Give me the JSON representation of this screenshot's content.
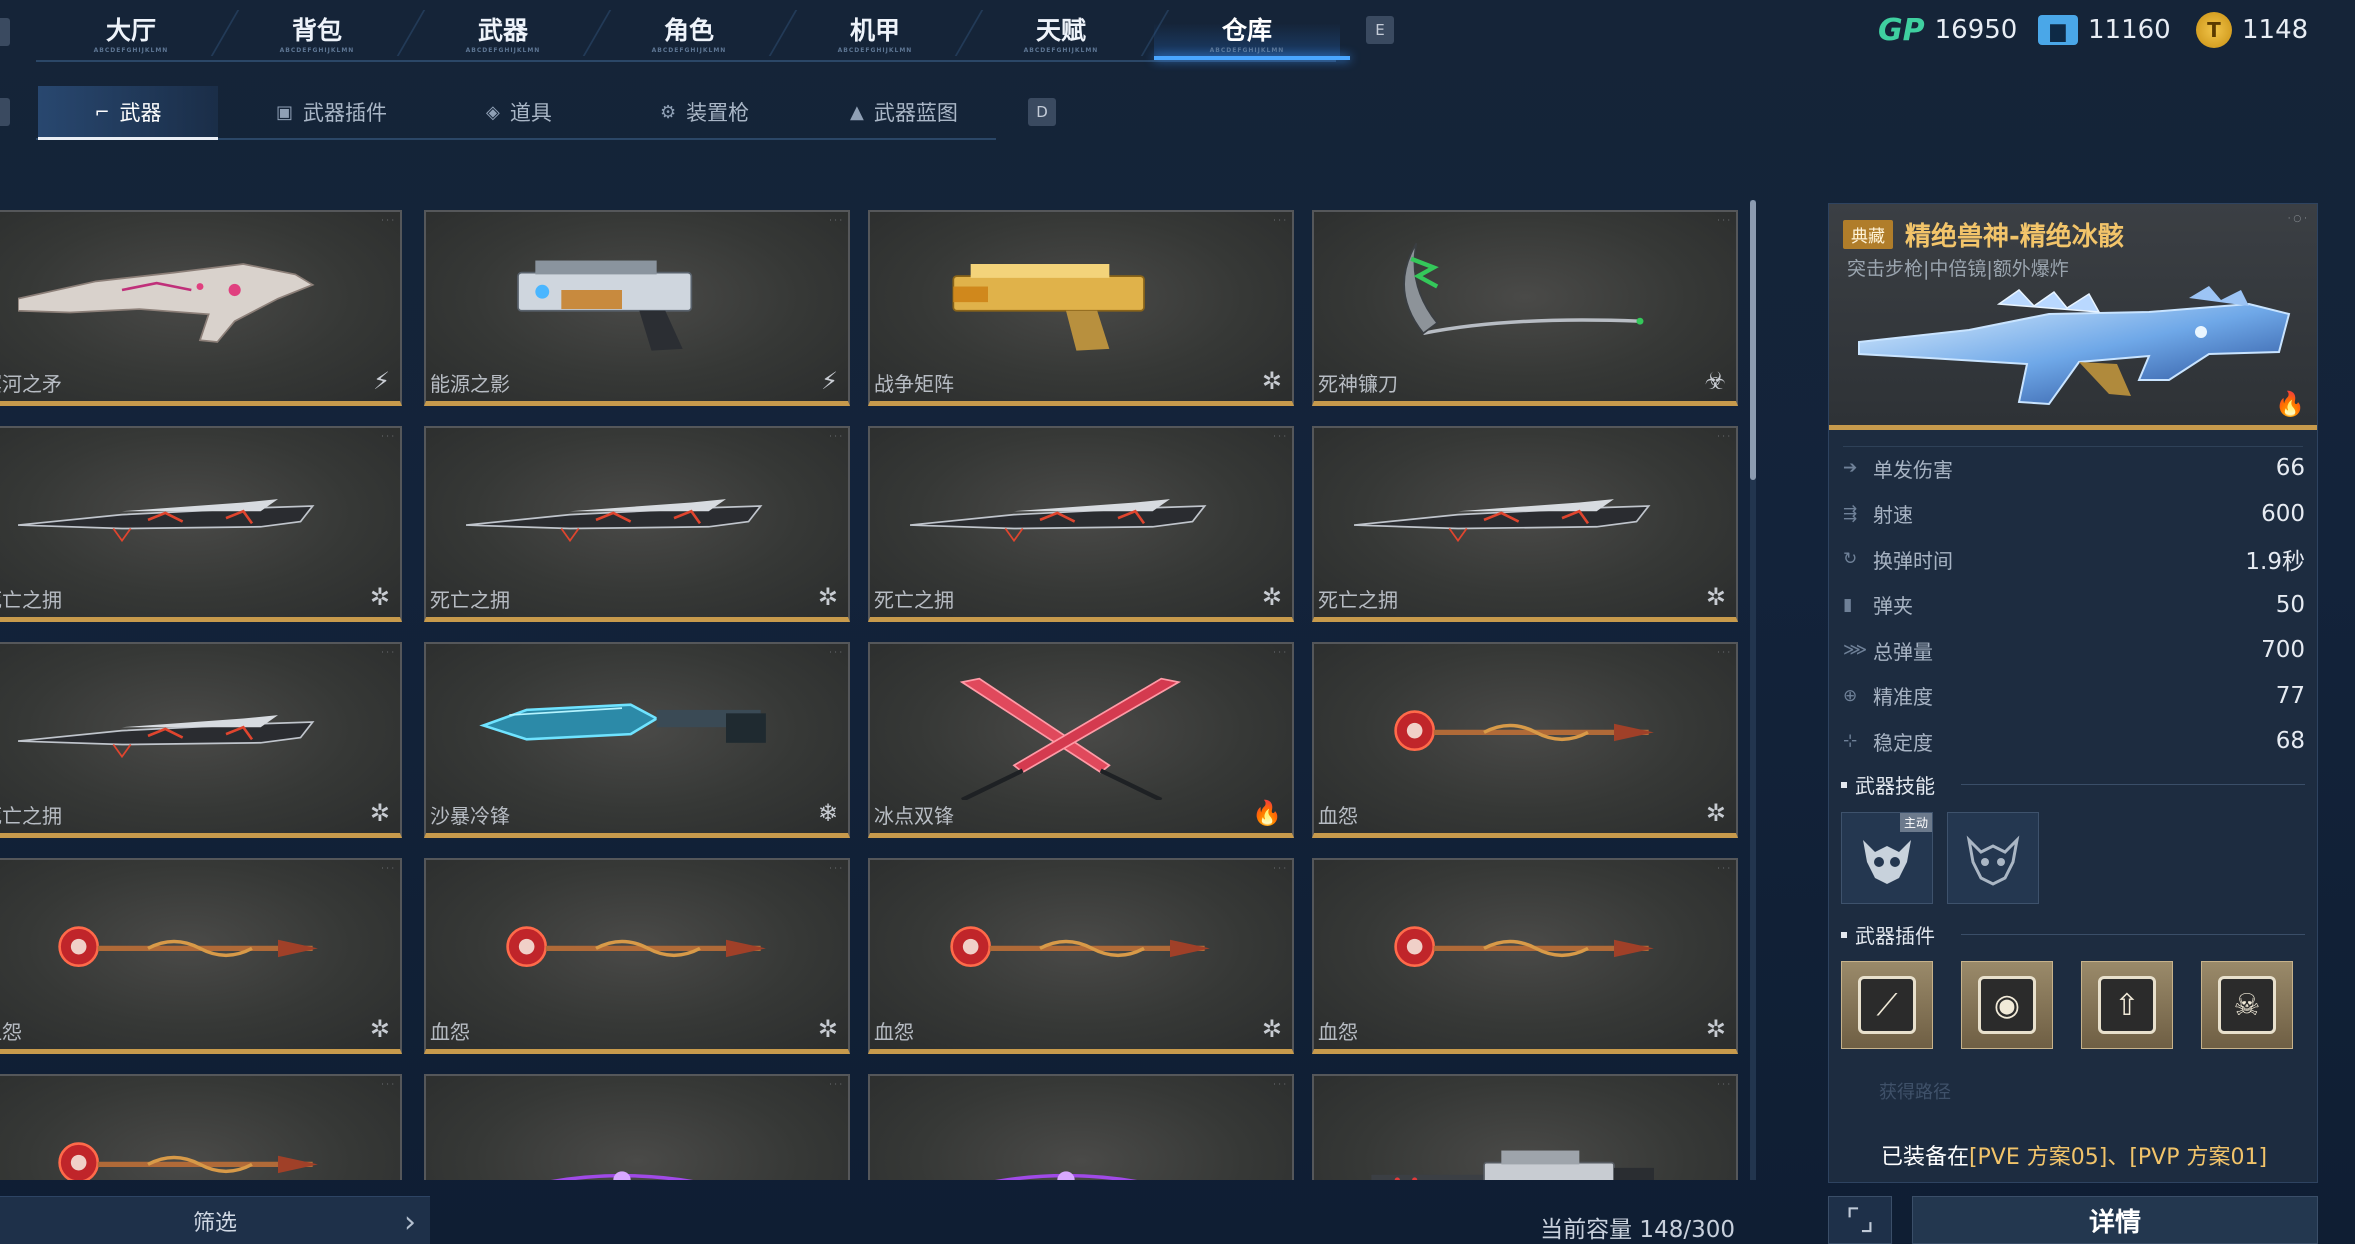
{
  "top_nav": {
    "tabs": [
      {
        "label": "大厅",
        "sub": "ABCDEFGHIJKLMN"
      },
      {
        "label": "背包",
        "sub": "ABCDEFGHIJKLMN"
      },
      {
        "label": "武器",
        "sub": "ABCDEFGHIJKLMN"
      },
      {
        "label": "角色",
        "sub": "ABCDEFGHIJKLMN"
      },
      {
        "label": "机甲",
        "sub": "ABCDEFGHIJKLMN"
      },
      {
        "label": "天赋",
        "sub": "ABCDEFGHIJKLMN"
      },
      {
        "label": "仓库",
        "sub": "ABCDEFGHIJKLMN"
      }
    ],
    "active_tab": "仓库",
    "next_key": "E"
  },
  "currency": {
    "gp_icon_text": "GP",
    "gp": "16950",
    "ticket": "11160",
    "coin": "1148"
  },
  "sub_nav": {
    "tabs": [
      {
        "label": "武器",
        "icon": "gun-icon"
      },
      {
        "label": "武器插件",
        "icon": "plugin-icon"
      },
      {
        "label": "道具",
        "icon": "item-icon"
      },
      {
        "label": "装置枪",
        "icon": "device-icon"
      },
      {
        "label": "武器蓝图",
        "icon": "blueprint-icon"
      }
    ],
    "active_tab": "武器",
    "next_key": "D"
  },
  "weapons": [
    {
      "name": "冥河之矛",
      "badge": "⚡",
      "kind": "bone-rifle"
    },
    {
      "name": "能源之影",
      "badge": "⚡",
      "kind": "pistol"
    },
    {
      "name": "战争矩阵",
      "badge": "✲",
      "kind": "gold-pistol"
    },
    {
      "name": "死神镰刀",
      "badge": "☣",
      "kind": "scythe"
    },
    {
      "name": "死亡之拥",
      "badge": "✲",
      "kind": "dark-sword"
    },
    {
      "name": "死亡之拥",
      "badge": "✲",
      "kind": "dark-sword"
    },
    {
      "name": "死亡之拥",
      "badge": "✲",
      "kind": "dark-sword"
    },
    {
      "name": "死亡之拥",
      "badge": "✲",
      "kind": "dark-sword"
    },
    {
      "name": "死亡之拥",
      "badge": "✲",
      "kind": "dark-sword"
    },
    {
      "name": "沙暴冷锋",
      "badge": "❄",
      "kind": "ice-knife"
    },
    {
      "name": "冰点双锋",
      "badge": "🔥",
      "kind": "twin-blades"
    },
    {
      "name": "血怨",
      "badge": "✲",
      "kind": "blood-spear"
    },
    {
      "name": "血怨",
      "badge": "✲",
      "kind": "blood-spear"
    },
    {
      "name": "血怨",
      "badge": "✲",
      "kind": "blood-spear"
    },
    {
      "name": "血怨",
      "badge": "✲",
      "kind": "blood-spear"
    },
    {
      "name": "血怨",
      "badge": "✲",
      "kind": "blood-spear"
    },
    {
      "name": "",
      "badge": "",
      "kind": "blood-spear"
    },
    {
      "name": "",
      "badge": "",
      "kind": "purple-staff"
    },
    {
      "name": "",
      "badge": "",
      "kind": "purple-staff"
    },
    {
      "name": "",
      "badge": "",
      "kind": "sniper"
    }
  ],
  "detail": {
    "rarity": "典藏",
    "name": "精绝兽神-精绝冰骸",
    "tags": "突击步枪|中倍镜|额外爆炸",
    "stats": [
      {
        "label": "单发伤害",
        "value": "66",
        "icon": "damage-icon"
      },
      {
        "label": "射速",
        "value": "600",
        "icon": "firerate-icon"
      },
      {
        "label": "换弹时间",
        "value": "1.9秒",
        "icon": "reload-icon"
      },
      {
        "label": "弹夹",
        "value": "50",
        "icon": "magazine-icon"
      },
      {
        "label": "总弹量",
        "value": "700",
        "icon": "ammo-icon"
      },
      {
        "label": "精准度",
        "value": "77",
        "icon": "accuracy-icon"
      },
      {
        "label": "稳定度",
        "value": "68",
        "icon": "stability-icon"
      }
    ],
    "skills_title": "武器技能",
    "skill_active_tag": "主动",
    "plugins_title": "武器插件",
    "source_label": "获得路径",
    "equipped_prefix": "已装备在",
    "equipped_hl": "[PVE 方案05]、[PVP 方案01]"
  },
  "bottom": {
    "filter_label": "筛选",
    "capacity": "当前容量 148/300",
    "detail_label": "详情"
  }
}
